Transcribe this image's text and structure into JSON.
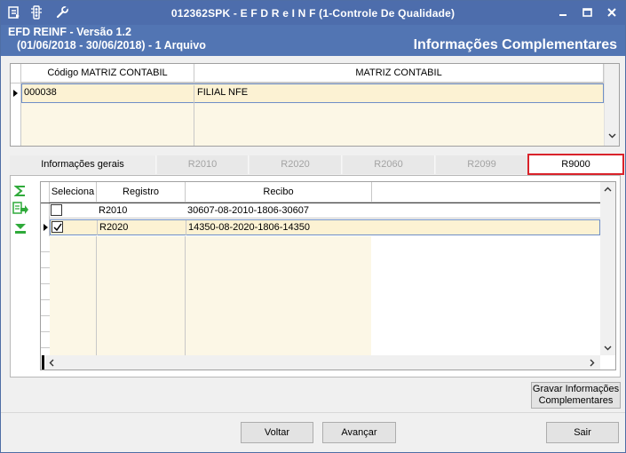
{
  "window": {
    "title": "012362SPK - E F D  R e I N F (1-Controle De Qualidade)"
  },
  "header": {
    "line1": "EFD REINF - Versão 1.2",
    "line2": "(01/06/2018 - 30/06/2018) - 1 Arquivo",
    "section_title": "Informações Complementares"
  },
  "matriz_grid": {
    "columns": [
      "Código MATRIZ CONTABIL",
      "MATRIZ CONTABIL"
    ],
    "rows": [
      {
        "codigo": "000038",
        "nome": "FILIAL NFE"
      }
    ]
  },
  "tabs": [
    {
      "label": "Informações gerais"
    },
    {
      "label": "R2010"
    },
    {
      "label": "R2020"
    },
    {
      "label": "R2060"
    },
    {
      "label": "R2099"
    },
    {
      "label": "R9000"
    }
  ],
  "active_tab": "R9000",
  "records_grid": {
    "columns": [
      "Seleciona",
      "Registro",
      "Recibo"
    ],
    "rows": [
      {
        "selected": false,
        "registro": "R2010",
        "recibo": "30607-08-2010-1806-30607"
      },
      {
        "selected": true,
        "registro": "R2020",
        "recibo": "14350-08-2020-1806-14350"
      }
    ]
  },
  "buttons": {
    "gravar_line1": "Gravar Informações",
    "gravar_line2": "Complementares",
    "voltar": "Voltar",
    "avancar": "Avançar",
    "sair": "Sair"
  },
  "colors": {
    "titlebar": "#4d6dac",
    "header": "#5275b3",
    "selected_row": "#fcf2d3",
    "active_tab_border": "#d9222a",
    "icon_green": "#2faa3a"
  }
}
